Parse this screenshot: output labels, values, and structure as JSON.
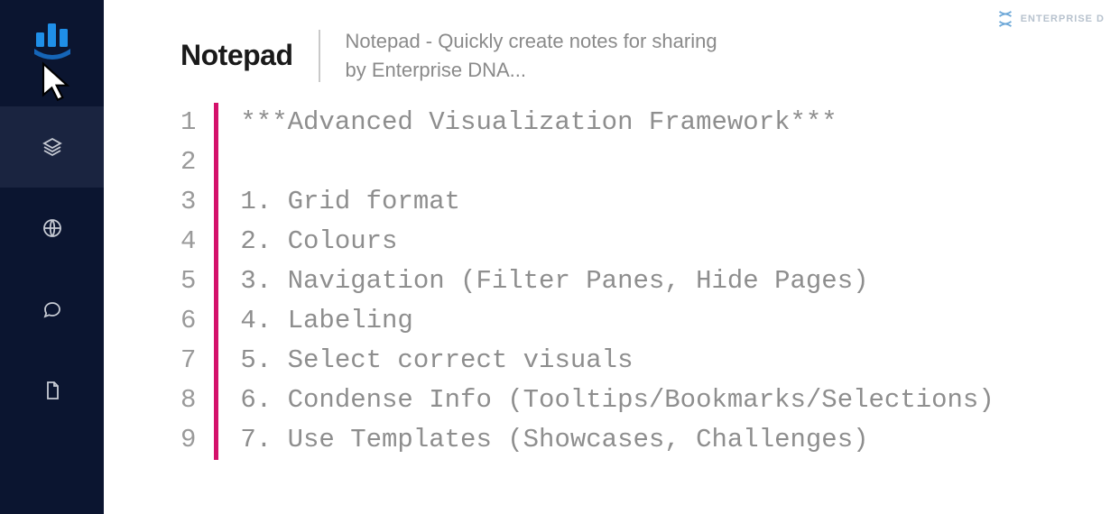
{
  "header": {
    "title": "Notepad",
    "subtitle_line1": "Notepad - Quickly create notes for sharing",
    "subtitle_line2": "by Enterprise DNA..."
  },
  "watermark": {
    "text": "ENTERPRISE D"
  },
  "sidebar": {
    "items": [
      {
        "name": "layers",
        "active": true
      },
      {
        "name": "globe",
        "active": false
      },
      {
        "name": "chat",
        "active": false
      },
      {
        "name": "document",
        "active": false
      }
    ]
  },
  "editor": {
    "lines": [
      {
        "num": "1",
        "text": "***Advanced Visualization Framework***"
      },
      {
        "num": "2",
        "text": ""
      },
      {
        "num": "3",
        "text": "1. Grid format"
      },
      {
        "num": "4",
        "text": "2. Colours"
      },
      {
        "num": "5",
        "text": "3. Navigation (Filter Panes, Hide Pages)"
      },
      {
        "num": "6",
        "text": "4. Labeling"
      },
      {
        "num": "7",
        "text": "5. Select correct visuals"
      },
      {
        "num": "8",
        "text": "6. Condense Info (Tooltips/Bookmarks/Selections)"
      },
      {
        "num": "9",
        "text": "7. Use Templates (Showcases, Challenges)"
      }
    ]
  },
  "colors": {
    "sidebar_bg": "#0b1530",
    "ruler": "#d4116b",
    "code_text": "#8e8e8e"
  }
}
